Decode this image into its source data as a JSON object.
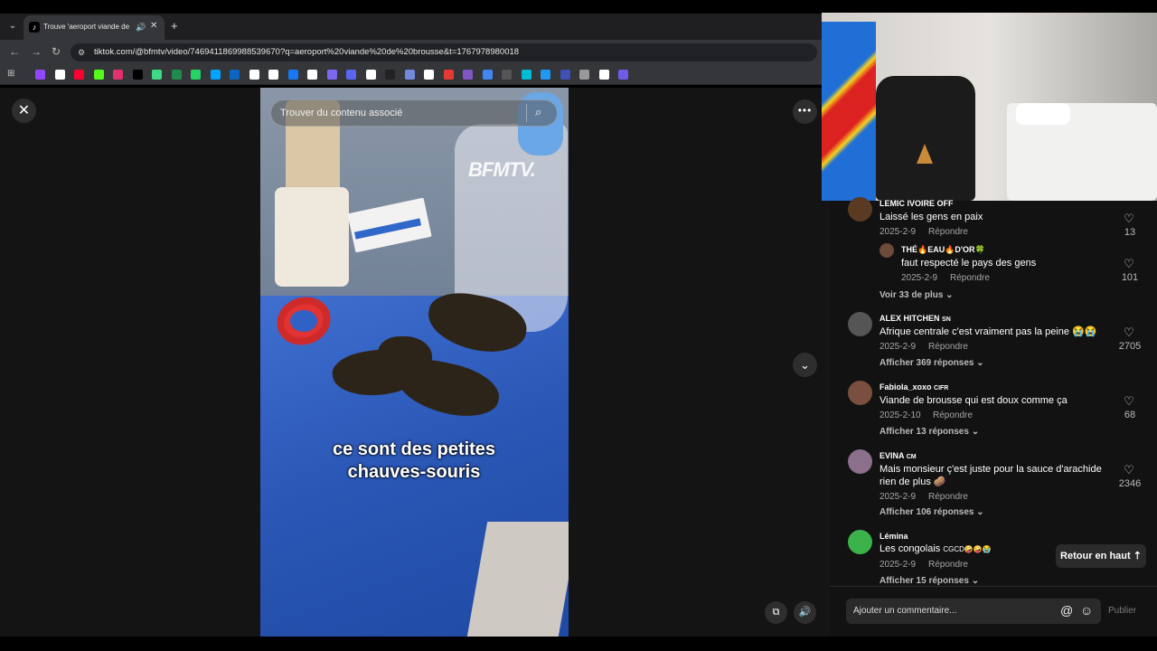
{
  "browser": {
    "tab_title": "Trouve 'aeroport viande de",
    "tab_favicon": "tiktok-favicon",
    "url": "tiktok.com/@bfmtv/video/7469411869988539670?q=aeroport%20viande%20de%20brousse&t=1767978980018",
    "icons": {
      "back": "back-arrow-icon",
      "forward": "forward-arrow-icon",
      "reload": "reload-icon",
      "audio": "speaker-icon"
    },
    "bookmark_colors": [
      "#9146ff",
      "#ffffff",
      "#ff0033",
      "#53fc18",
      "#e1306c",
      "#000000",
      "#3ddc84",
      "#1f8b4c",
      "#25d366",
      "#00a3ff",
      "#0a66c2",
      "#ffffff",
      "#ffffff",
      "#1877f2",
      "#ffffff",
      "#7b68ee",
      "#5865f2",
      "#ffffff",
      "#222222",
      "#7289da",
      "#ffffff",
      "#e53935",
      "#7e57c2",
      "#4285f4",
      "#555555",
      "#00bcd4",
      "#2196f3",
      "#3f51b5",
      "#999999",
      "#ffffff",
      "#6c5ce7"
    ]
  },
  "video": {
    "search_placeholder": "Trouver du contenu associé",
    "watermark": "BFMTV.",
    "caption_line1": "ce sont des petites",
    "caption_line2": "chauves-souris"
  },
  "controls": {
    "close_icon": "close-icon",
    "more_icon": "more-horizontal-icon",
    "down_icon": "chevron-down-icon",
    "pip_icon": "picture-in-picture-icon",
    "volume_icon": "volume-icon"
  },
  "comments": [
    {
      "name": "LEMIC IVOIRE OFF",
      "text": "Laissé les gens en paix",
      "date": "2025-2-9",
      "reply": "Répondre",
      "likes": "13",
      "avatar_color": "#5a3b22"
    },
    {
      "name": "THÉ🔥EAU🔥D'OR🍀",
      "text": "faut respecté le pays des gens",
      "date": "2025-2-9",
      "reply": "Répondre",
      "likes": "101",
      "avatar_color": "#6d4a3a"
    },
    {
      "name": "ALEX HITCHEN",
      "badge": "SN",
      "text": "Afrique centrale c'est vraiment pas la peine 😭😭",
      "date": "2025-2-9",
      "reply": "Répondre",
      "likes": "2705",
      "avatar_color": "#555555"
    },
    {
      "name": "Fabiola_xoxo",
      "badge": "CIFR",
      "text": "Viande de brousse qui est doux comme ça",
      "date": "2025-2-10",
      "reply": "Répondre",
      "likes": "68",
      "avatar_color": "#7a4f3f"
    },
    {
      "name": "EVINA",
      "badge": "CM",
      "text": "Mais monsieur ç'est juste pour la sauce d'arachide rien de plus 🥔",
      "date": "2025-2-9",
      "reply": "Répondre",
      "likes": "2346",
      "avatar_color": "#8b6f8b"
    },
    {
      "name": "Lémina",
      "text": "Les congolais",
      "text_suffix": "CGCD🤪🤪😭",
      "date": "2025-2-9",
      "reply": "Répondre",
      "avatar_color": "#3bb34a"
    }
  ],
  "expanders": {
    "voir_33": "Voir 33 de plus",
    "rep_369": "Afficher 369 réponses",
    "rep_13": "Afficher 13 réponses",
    "rep_106": "Afficher 106 réponses",
    "rep_15": "Afficher 15 réponses"
  },
  "back_to_top": "Retour en haut",
  "composer": {
    "placeholder": "Ajouter un commentaire...",
    "publish": "Publier"
  }
}
